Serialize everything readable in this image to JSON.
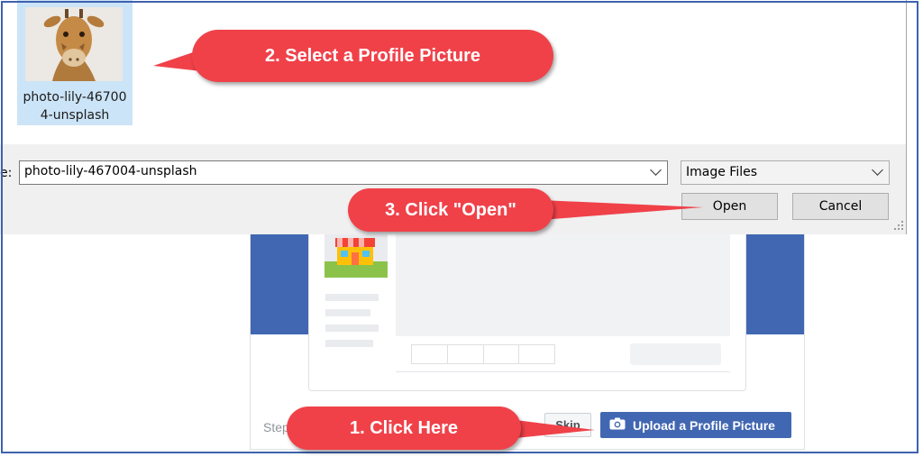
{
  "dialog": {
    "file": {
      "name": "photo-lily-467004-unsplash",
      "name_line1": "photo-lily-46700",
      "name_line2": "4-unsplash",
      "thumbnail_icon": "giraffe-photo"
    },
    "filename_label": "e:",
    "filename_value": "photo-lily-467004-unsplash",
    "filetype_value": "Image Files",
    "open_label": "Open",
    "cancel_label": "Cancel"
  },
  "page": {
    "step_text": "Step",
    "skip_label": "Skip",
    "upload_label": "Upload a Profile Picture",
    "upload_icon": "camera-icon"
  },
  "callouts": {
    "step1": "1.  Click Here",
    "step2": "2. Select a Profile Picture",
    "step3": "3. Click \"Open\""
  },
  "colors": {
    "callout": "#f04149",
    "facebook_blue": "#4267b2",
    "selection": "#cce4f7",
    "frame": "#3f62ae"
  }
}
